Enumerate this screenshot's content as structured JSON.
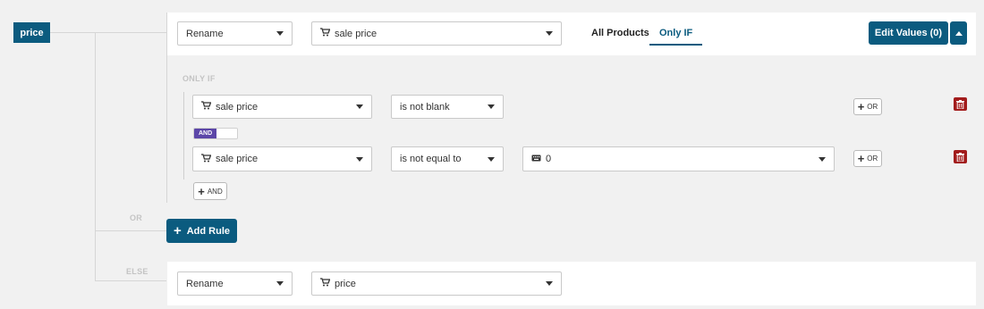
{
  "field": {
    "name": "price"
  },
  "rule_main": {
    "action": "Rename",
    "value": "sale price",
    "tabs": [
      {
        "label": "All Products",
        "active": false
      },
      {
        "label": "Only IF",
        "active": true
      }
    ],
    "edit_values_label": "Edit Values (0)"
  },
  "conditions": {
    "heading": "ONLY IF",
    "rows": [
      {
        "field": "sale price",
        "operator": "is not blank"
      },
      {
        "field": "sale price",
        "operator": "is not equal to",
        "value": "0"
      }
    ],
    "or_label": "OR",
    "and_toggle_label": "AND",
    "add_and_label": "AND"
  },
  "or_label": "OR",
  "add_rule_label": "Add Rule",
  "else_label": "ELSE",
  "rule_else": {
    "action": "Rename",
    "value": "price"
  },
  "colors": {
    "primary": "#0b5b7f",
    "danger": "#a21c1c",
    "and": "#5c46a8"
  }
}
